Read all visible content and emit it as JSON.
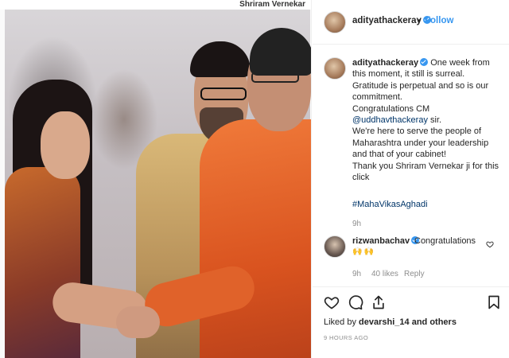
{
  "photo": {
    "credit": "Shriram Vernekar"
  },
  "header": {
    "username": "adityathackeray",
    "separator": "•",
    "follow_label": "Follow"
  },
  "caption": {
    "username": "adityathackeray",
    "lines": [
      "One week from this moment, it still is surreal.",
      "Gratitude is perpetual and so is our commitment.",
      "Congratulations CM",
      "@uddhavthackeray",
      "sir.",
      "We're here to serve the people of Maharashtra under your leadership and that of your cabinet!",
      "Thank you Shriram Vernekar ji for this click"
    ],
    "hashtag": "#MahaVikasAghadi",
    "time": "9h"
  },
  "comment": {
    "username": "rizwanbachav",
    "text": "Congratulations",
    "emoji": "🙌🙌",
    "time": "9h",
    "likes": "40 likes",
    "reply": "Reply"
  },
  "post": {
    "liked_by_prefix": "Liked by",
    "liked_by_user": "devarshi_14",
    "liked_by_suffix": "and others",
    "time_ago": "9 HOURS AGO"
  },
  "colors": {
    "link": "#003569",
    "accent": "#3897f0",
    "muted": "#8e8e8e"
  }
}
